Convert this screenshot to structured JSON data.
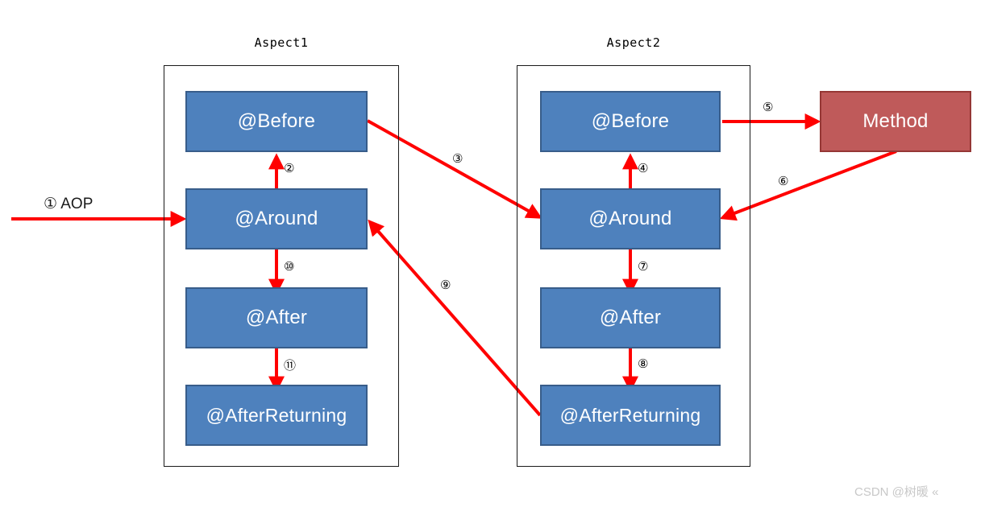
{
  "diagram": {
    "title_aspect1": "Aspect1",
    "title_aspect2": "Aspect2",
    "entry_label": "①  AOP",
    "watermark": "CSDN @树暖 «",
    "colors": {
      "advice_fill": "#4e81bd",
      "advice_border": "#385d8a",
      "method_fill": "#bf5a5a",
      "method_border": "#953735",
      "arrow": "#ff0000",
      "group_border": "#1a1a1a"
    },
    "aspect1": {
      "label": "Aspect1",
      "nodes": [
        {
          "id": "a1-before",
          "label": "@Before"
        },
        {
          "id": "a1-around",
          "label": "@Around"
        },
        {
          "id": "a1-after",
          "label": "@After"
        },
        {
          "id": "a1-afterreturning",
          "label": "@AfterReturning"
        }
      ]
    },
    "aspect2": {
      "label": "Aspect2",
      "nodes": [
        {
          "id": "a2-before",
          "label": "@Before"
        },
        {
          "id": "a2-around",
          "label": "@Around"
        },
        {
          "id": "a2-after",
          "label": "@After"
        },
        {
          "id": "a2-afterreturning",
          "label": "@AfterReturning"
        }
      ]
    },
    "method": {
      "id": "method",
      "label": "Method"
    },
    "flow_steps": [
      {
        "num": "①",
        "label": "①  AOP",
        "from": "entry",
        "to": "a1-around"
      },
      {
        "num": "②",
        "label": "②",
        "from": "a1-around",
        "to": "a1-before"
      },
      {
        "num": "③",
        "label": "③",
        "from": "a1-before",
        "to": "a2-around"
      },
      {
        "num": "④",
        "label": "④",
        "from": "a2-around",
        "to": "a2-before"
      },
      {
        "num": "⑤",
        "label": "⑤",
        "from": "a2-before",
        "to": "method"
      },
      {
        "num": "⑥",
        "label": "⑥",
        "from": "method",
        "to": "a2-around"
      },
      {
        "num": "⑦",
        "label": "⑦",
        "from": "a2-around",
        "to": "a2-after"
      },
      {
        "num": "⑧",
        "label": "⑧",
        "from": "a2-after",
        "to": "a2-afterreturning"
      },
      {
        "num": "⑨",
        "label": "⑨",
        "from": "a2-afterreturning",
        "to": "a1-around"
      },
      {
        "num": "⑩",
        "label": "⑩",
        "from": "a1-around",
        "to": "a1-after"
      },
      {
        "num": "⑪",
        "label": "⑪",
        "from": "a1-after",
        "to": "a1-afterreturning"
      }
    ]
  }
}
